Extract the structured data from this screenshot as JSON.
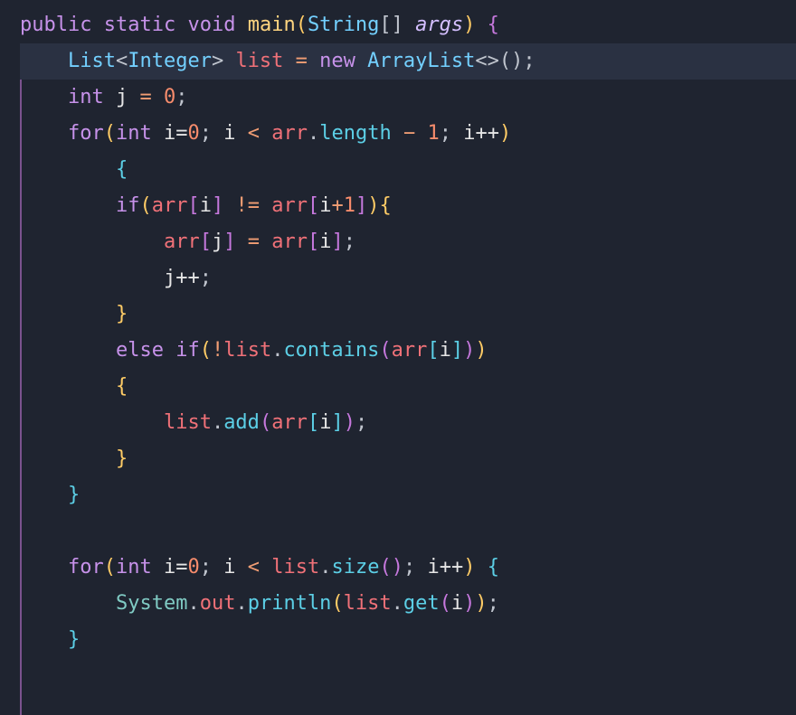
{
  "code": {
    "line1": {
      "public": "public",
      "static": "static",
      "void": "void",
      "main": "main",
      "lp": "(",
      "String": "String",
      "lb": "[",
      "rb": "]",
      "sp": " ",
      "args": "args",
      "rp": ")",
      "lc": " {"
    },
    "line2": {
      "List": "List",
      "lt": "<",
      "Integer": "Integer",
      "gt": ">",
      "sp": " ",
      "list": "list",
      "eq": " = ",
      "new": "new",
      "sp2": " ",
      "ArrayList": "ArrayList",
      "diamond": "<>",
      "end": "();"
    },
    "line3": {
      "int": "int",
      "sp": " ",
      "j": "j",
      "eq": " = ",
      "zero": "0",
      "semi": ";"
    },
    "line4": {
      "for": "for",
      "lp": "(",
      "int": "int",
      "sp": " ",
      "ieq": "i=",
      "zero": "0",
      "semi1": "; ",
      "i": "i",
      "lt": " < ",
      "arr": "arr",
      "dot": ".",
      "length": "length",
      "minus": " − ",
      "one": "1",
      "semi2": "; ",
      "ipp": "i++",
      "rp": ")"
    },
    "line5": {
      "lc": "{"
    },
    "line6": {
      "if": "if",
      "lp": "(",
      "arr1": "arr",
      "lb1": "[",
      "i1": "i",
      "rb1": "]",
      "ne": " != ",
      "arr2": "arr",
      "lb2": "[",
      "i2": "i",
      "plus": "+",
      "one": "1",
      "rb2": "]",
      "rp": ")",
      "lc": "{"
    },
    "line7": {
      "arrj": "arr",
      "lb1": "[",
      "j": "j",
      "rb1": "]",
      "eq": " = ",
      "arri": "arr",
      "lb2": "[",
      "i": "i",
      "rb2": "]",
      "semi": ";"
    },
    "line8": {
      "jpp": "j++",
      "semi": ";"
    },
    "line9": {
      "rc": "}"
    },
    "line10": {
      "else": "else",
      "sp": " ",
      "if": "if",
      "lp": "(",
      "not": "!",
      "list": "list",
      "dot": ".",
      "contains": "contains",
      "lp2": "(",
      "arr": "arr",
      "lb": "[",
      "i": "i",
      "rb": "]",
      "rp2": ")",
      "rp": ")"
    },
    "line11": {
      "lc": "{"
    },
    "line12": {
      "list": "list",
      "dot": ".",
      "add": "add",
      "lp": "(",
      "arr": "arr",
      "lb": "[",
      "i": "i",
      "rb": "]",
      "rp": ")",
      "semi": ";"
    },
    "line13": {
      "rc": "}"
    },
    "line14": {
      "rc": "}"
    },
    "line15": {
      "empty": ""
    },
    "line16": {
      "for": "for",
      "lp": "(",
      "int": "int",
      "sp": " ",
      "ieq": "i=",
      "zero": "0",
      "semi1": "; ",
      "i": "i",
      "lt": " < ",
      "list": "list",
      "dot": ".",
      "size": "size",
      "paren": "()",
      "semi2": "; ",
      "ipp": "i++",
      "rp": ")",
      "lc": " {"
    },
    "line17": {
      "System": "System",
      "dot1": ".",
      "out": "out",
      "dot2": ".",
      "println": "println",
      "lp": "(",
      "list": "list",
      "dot3": ".",
      "get": "get",
      "lp2": "(",
      "i": "i",
      "rp2": ")",
      "rp": ")",
      "semi": ";"
    },
    "line18": {
      "rc": "}"
    }
  }
}
